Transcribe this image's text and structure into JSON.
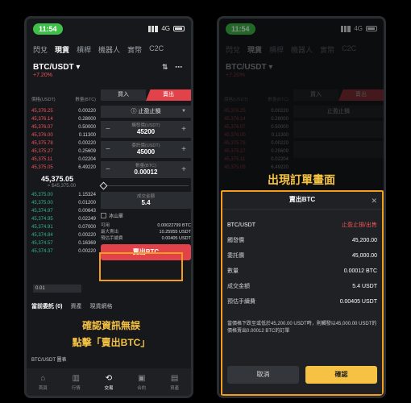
{
  "status": {
    "time": "11:54",
    "network": "4G"
  },
  "tabs": [
    "閃兌",
    "現貨",
    "槓桿",
    "機器人",
    "實幣",
    "C2C"
  ],
  "pair": {
    "name": "BTC/USDT",
    "change": "+7.20%"
  },
  "book": {
    "header_price": "價格(USDT)",
    "header_qty": "數量(BTC)",
    "asks": [
      [
        "45,376.25",
        "0.00220"
      ],
      [
        "45,376.14",
        "0.28000"
      ],
      [
        "45,376.07",
        "0.50000"
      ],
      [
        "45,376.00",
        "0.11300"
      ],
      [
        "45,375.78",
        "0.00220"
      ],
      [
        "45,375.27",
        "0.25609"
      ],
      [
        "45,375.11",
        "0.02204"
      ],
      [
        "45,375.05",
        "6.49220"
      ]
    ],
    "last": "45,375.05",
    "last_sub": "≈ $45,375.00",
    "bids": [
      [
        "45,375.00",
        "1.15324"
      ],
      [
        "45,375.00",
        "0.01200"
      ],
      [
        "45,374.97",
        "0.00643"
      ],
      [
        "45,374.95",
        "0.02249"
      ],
      [
        "45,374.91",
        "0.07000"
      ],
      [
        "45,374.84",
        "0.00220"
      ],
      [
        "45,374.57",
        "0.16369"
      ],
      [
        "45,374.37",
        "0.00220"
      ]
    ]
  },
  "form": {
    "buy": "買入",
    "sell": "賣出",
    "order_type": "止盈止損",
    "trigger_label": "觸發價(USDT)",
    "trigger": "45200",
    "price_label": "委託價(USDT)",
    "price": "45000",
    "qty_label": "數量(BTC)",
    "qty": "0.00012",
    "total_label": "成交金額",
    "total": "5.4",
    "iceberg": "冰山單",
    "avail_label": "可用",
    "avail": "0.00022799 BTC",
    "maxsell_label": "最大賣出",
    "maxsell": "10.25955 USDT",
    "fee_label": "預估手續費",
    "fee": "0.00405 USDT",
    "sell_btn": "賣出BTC",
    "lot": "0.01"
  },
  "orders": {
    "tab1": "當前委託 (0)",
    "tab2": "資產",
    "tab3": "現貨網格"
  },
  "caption_left": {
    "line1": "確認資訊無誤",
    "line2": "點擊「賣出BTC」"
  },
  "chart_row": "BTC/USDT 圖表",
  "nav": [
    "首頁",
    "行情",
    "交易",
    "合約",
    "資產"
  ],
  "overlay_title": "出現訂單畫面",
  "modal": {
    "title": "賣出BTC",
    "pair": "BTC/USDT",
    "side": "止盈止損/出售",
    "rows": [
      [
        "觸發價",
        "45,200.00"
      ],
      [
        "委託價",
        "45,000.00"
      ],
      [
        "數量",
        "0.00012 BTC"
      ],
      [
        "成交金額",
        "5.4 USDT"
      ],
      [
        "預估手續費",
        "0.00405 USDT"
      ]
    ],
    "note": "當價格下跌至或低於45,200.00 USDT時，則觸發以45,000.00 USDT的價格賣出0.00012 BTC的訂單",
    "cancel": "取消",
    "confirm": "確認"
  }
}
